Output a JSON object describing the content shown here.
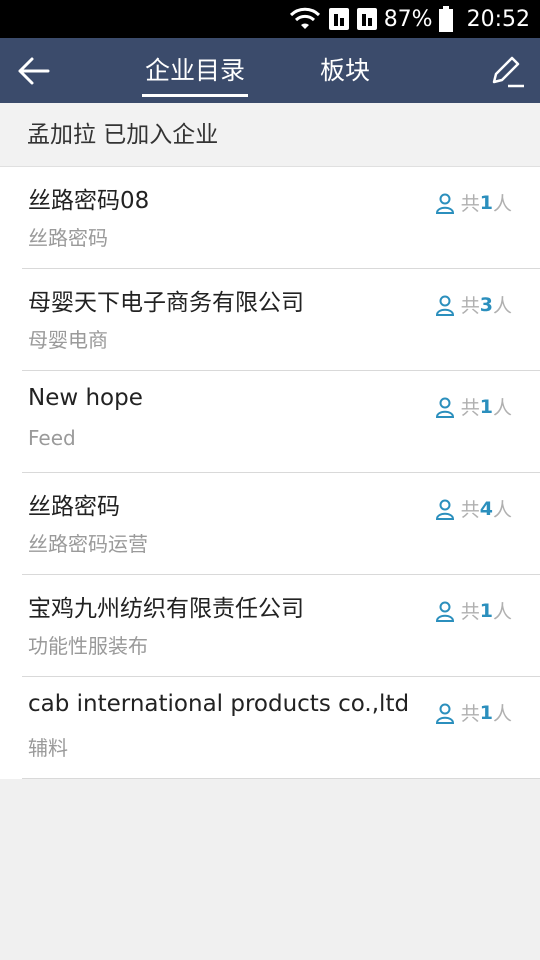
{
  "status_bar": {
    "battery": "87%",
    "time": "20:52"
  },
  "nav": {
    "tab_directory": "企业目录",
    "tab_board": "板块"
  },
  "section": {
    "title": "孟加拉 已加入企业"
  },
  "count_prefix": "共",
  "count_suffix": "人",
  "companies": [
    {
      "name": "丝路密码08",
      "sub": "丝路密码",
      "count": "1"
    },
    {
      "name": "母婴天下电子商务有限公司",
      "sub": "母婴电商",
      "count": "3"
    },
    {
      "name": "New hope",
      "sub": "Feed",
      "count": "1"
    },
    {
      "name": "丝路密码",
      "sub": "丝路密码运营",
      "count": "4"
    },
    {
      "name": "宝鸡九州纺织有限责任公司",
      "sub": "功能性服装布",
      "count": "1"
    },
    {
      "name": "cab international products co.,ltd",
      "sub": "辅料",
      "count": "1"
    }
  ],
  "colors": {
    "nav_bg": "#3b4b6b",
    "accent": "#2b8fbd"
  }
}
